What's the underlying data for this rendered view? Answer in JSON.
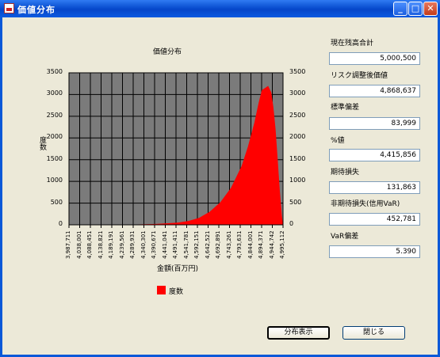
{
  "window": {
    "title": "価値分布"
  },
  "chart_data": {
    "type": "area",
    "title": "価値分布",
    "xlabel": "金額(百万円)",
    "ylabel": "度数",
    "ylim": [
      0,
      3500
    ],
    "yticks": [
      "3500",
      "3000",
      "2500",
      "2000",
      "1500",
      "1000",
      "500",
      "0"
    ],
    "ytick_values": [
      3500,
      3000,
      2500,
      2000,
      1500,
      1000,
      500,
      0
    ],
    "xticks": [
      "3,987,711",
      "4,038,001",
      "4,088,451",
      "4,138,821",
      "4,189,191",
      "4,239,561",
      "4,289,931",
      "4,340,301",
      "4,390,671",
      "4,441,041",
      "4,491,411",
      "4,541,781",
      "4,592,151",
      "4,642,521",
      "4,692,891",
      "4,743,261",
      "4,793,631",
      "4,844,001",
      "4,894,371",
      "4,944,742",
      "4,995,112"
    ],
    "series": [
      {
        "name": "度数",
        "x": [
          3987711,
          4240000,
          4400000,
          4500000,
          4550000,
          4600000,
          4650000,
          4700000,
          4750000,
          4800000,
          4830000,
          4860000,
          4880000,
          4895000,
          4910000,
          4925000,
          4940000,
          4950000,
          4960000,
          4970000,
          4980000,
          4990000,
          4995112
        ],
        "values": [
          0,
          0,
          20,
          50,
          90,
          160,
          300,
          520,
          850,
          1350,
          1800,
          2350,
          2800,
          3100,
          3150,
          3200,
          3050,
          2700,
          2200,
          1500,
          800,
          200,
          0
        ]
      }
    ],
    "legend": "bottom-left",
    "grid": true
  },
  "stats": [
    {
      "label": "現在残高合計",
      "value": "5,000,500"
    },
    {
      "label": "リスク調整後価値",
      "value": "4,868,637"
    },
    {
      "label": "標準偏差",
      "value": "83,999"
    },
    {
      "label": "%値",
      "value": "4,415,856"
    },
    {
      "label": "期待損失",
      "value": "131,863"
    },
    {
      "label": "非期待損失(信用VaR)",
      "value": "452,781"
    },
    {
      "label": "VaR偏差",
      "value": "5.390"
    }
  ],
  "buttons": {
    "show": "分布表示",
    "close": "閉じる"
  },
  "colors": {
    "plot_bg": "#7b7b7b",
    "series": "#ff0000",
    "titlebar": "#0a4fd0"
  }
}
